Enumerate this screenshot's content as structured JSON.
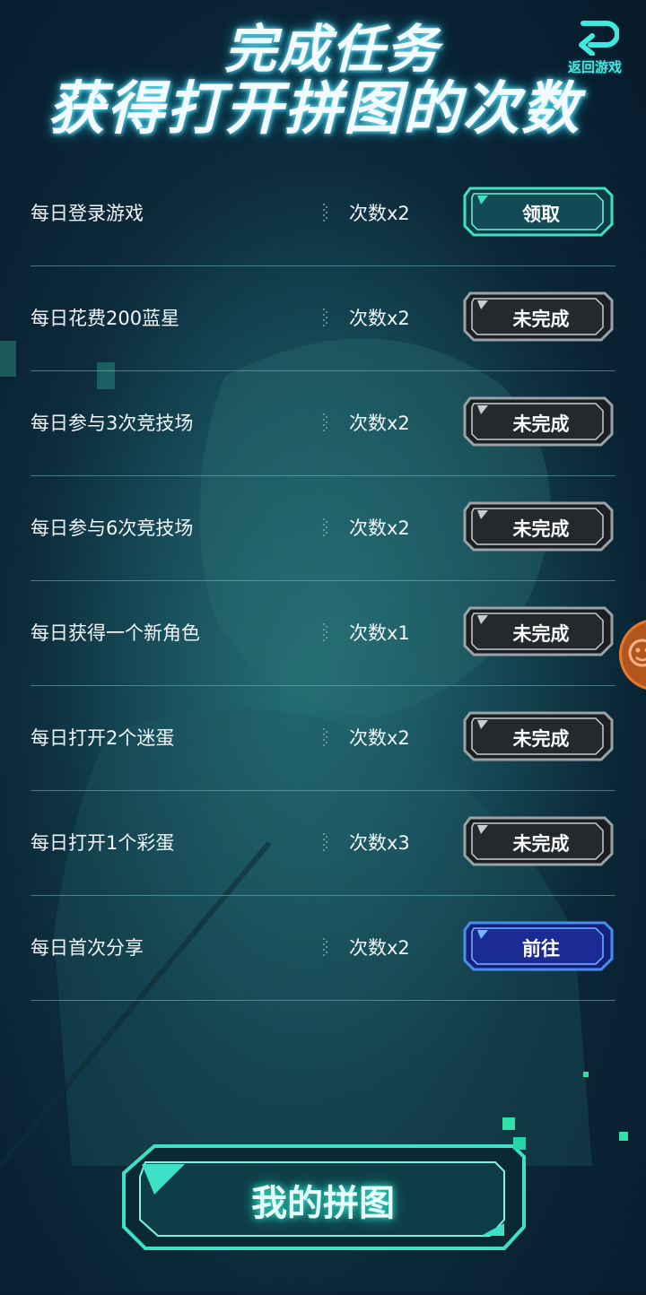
{
  "header": {
    "title_line1": "完成任务",
    "title_line2": "获得打开拼图的次数",
    "back_label": "返回游戏"
  },
  "tasks": [
    {
      "name": "每日登录游戏",
      "reward": "次数x2",
      "button": "领取",
      "state": "claim"
    },
    {
      "name": "每日花费200蓝星",
      "reward": "次数x2",
      "button": "未完成",
      "state": "incomplete"
    },
    {
      "name": "每日参与3次竞技场",
      "reward": "次数x2",
      "button": "未完成",
      "state": "incomplete"
    },
    {
      "name": "每日参与6次竞技场",
      "reward": "次数x2",
      "button": "未完成",
      "state": "incomplete"
    },
    {
      "name": "每日获得一个新角色",
      "reward": "次数x1",
      "button": "未完成",
      "state": "incomplete"
    },
    {
      "name": "每日打开2个迷蛋",
      "reward": "次数x2",
      "button": "未完成",
      "state": "incomplete"
    },
    {
      "name": "每日打开1个彩蛋",
      "reward": "次数x3",
      "button": "未完成",
      "state": "incomplete"
    },
    {
      "name": "每日首次分享",
      "reward": "次数x2",
      "button": "前往",
      "state": "goto"
    }
  ],
  "bottom": {
    "my_puzzle_label": "我的拼图"
  },
  "colors": {
    "accent_teal": "#3fe0c8",
    "claim_fill": "#0e3f4a",
    "incomplete_fill": "#1d2226",
    "goto_fill": "#1a2a8a",
    "side_float": "#b3561d"
  },
  "icons": {
    "back": "return-arrow-icon",
    "side": "face-icon"
  }
}
